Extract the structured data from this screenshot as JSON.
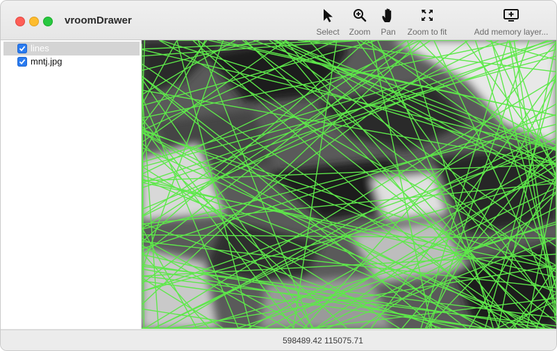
{
  "window": {
    "title": "vroomDrawer"
  },
  "toolbar": {
    "select_label": "Select",
    "zoom_label": "Zoom",
    "pan_label": "Pan",
    "zoom_to_fit_label": "Zoom to fit",
    "add_memory_layer_label": "Add memory layer..."
  },
  "layers": [
    {
      "name": "lines",
      "checked": true,
      "selected": true
    },
    {
      "name": "mntj.jpg",
      "checked": true,
      "selected": false
    }
  ],
  "status": {
    "coords": "598489.42  115075.71"
  },
  "colors": {
    "line": "#5ee84a",
    "check": "#2a7bf0"
  },
  "icons": [
    "arrow-cursor-icon",
    "zoom-in-icon",
    "hand-icon",
    "expand-icon",
    "add-display-icon",
    "checkmark-icon"
  ]
}
